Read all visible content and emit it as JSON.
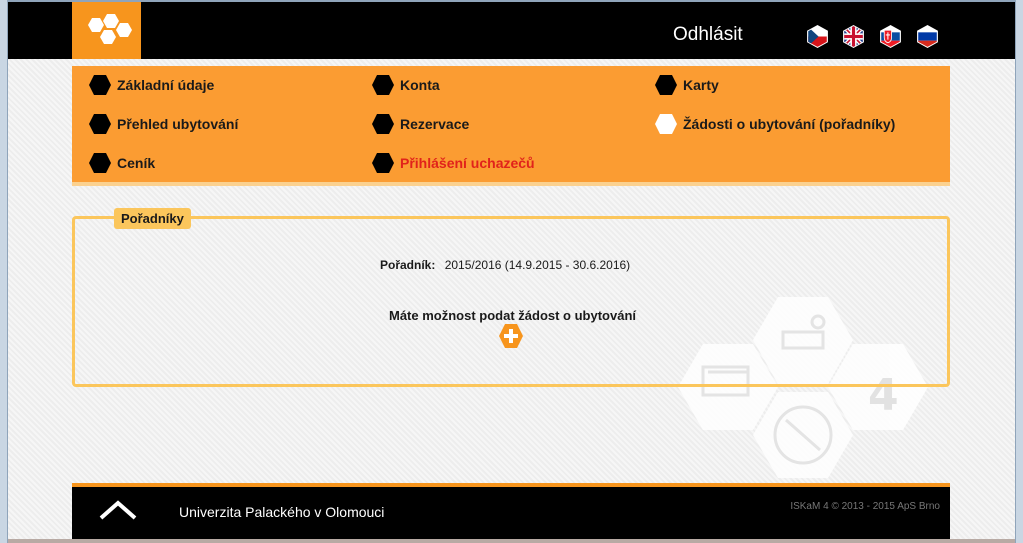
{
  "header": {
    "logout_label": "Odhlásit",
    "languages": [
      "cz-flag-icon",
      "uk-flag-icon",
      "sk-flag-icon",
      "ru-flag-icon"
    ]
  },
  "nav": {
    "items": [
      {
        "label": "Základní údaje",
        "active": false
      },
      {
        "label": "Konta",
        "active": false
      },
      {
        "label": "Karty",
        "active": false
      },
      {
        "label": "Přehled ubytování",
        "active": false
      },
      {
        "label": "Rezervace",
        "active": false
      },
      {
        "label": "Žádosti o ubytování (pořadníky)",
        "active": true
      },
      {
        "label": "Ceník",
        "active": false
      },
      {
        "label": "Přihlášení uchazečů",
        "highlight": "#e1231b"
      }
    ]
  },
  "panel": {
    "legend": "Pořadníky",
    "queue_label": "Pořadník:",
    "queue_value": "2015/2016 (14.9.2015 - 30.6.2016)",
    "notice": "Máte možnost podat žádost o ubytování",
    "add_icon": "plus-icon",
    "watermark_text": "4"
  },
  "footer": {
    "university": "Univerzita Palackého v Olomouci",
    "copyright": "ISKaM 4 © 2013 - 2015 ApS Brno"
  },
  "colors": {
    "accent": "#f7951d",
    "nav_bg": "#fb9c32",
    "panel_border": "#fbc65c",
    "header_bg": "#000000"
  }
}
